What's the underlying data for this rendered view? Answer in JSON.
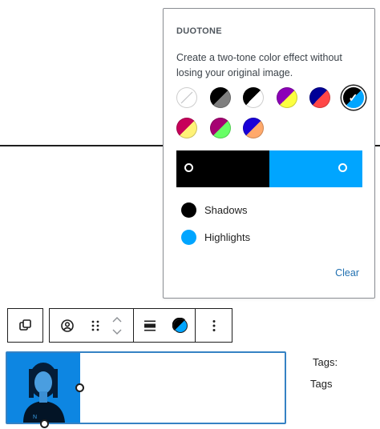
{
  "duotone_panel": {
    "title": "DUOTONE",
    "description": "Create a two-tone color effect without losing your original image.",
    "presets": [
      {
        "name": "none",
        "shadow": "#ffffff",
        "highlight": "#ffffff",
        "selected": false
      },
      {
        "name": "dark-grayscale",
        "shadow": "#000000",
        "highlight": "#7f7f7f",
        "selected": false
      },
      {
        "name": "grayscale",
        "shadow": "#000000",
        "highlight": "#ffffff",
        "selected": false
      },
      {
        "name": "purple-yellow",
        "shadow": "#8c00b7",
        "highlight": "#fcff41",
        "selected": false
      },
      {
        "name": "blue-red",
        "shadow": "#000097",
        "highlight": "#ff4747",
        "selected": false
      },
      {
        "name": "midnight",
        "shadow": "#000000",
        "highlight": "#00a5ff",
        "selected": true
      },
      {
        "name": "magenta-yellow",
        "shadow": "#c7005a",
        "highlight": "#fff278",
        "selected": false
      },
      {
        "name": "purple-green",
        "shadow": "#a60072",
        "highlight": "#67ff66",
        "selected": false
      },
      {
        "name": "blue-orange",
        "shadow": "#1900d8",
        "highlight": "#ffa96b",
        "selected": false
      }
    ],
    "gradient": {
      "shadow_color": "#000000",
      "highlight_color": "#00a5ff"
    },
    "shadows_label": "Shadows",
    "highlights_label": "Highlights",
    "clear_label": "Clear"
  },
  "toolbar": {
    "items": [
      "transform-icon",
      "avatar-icon",
      "drag-handle-icon",
      "move-up-icon",
      "move-down-icon",
      "align-icon",
      "duotone-icon",
      "more-options-icon"
    ]
  },
  "tags": {
    "label": "Tags:",
    "value": "Tags"
  }
}
